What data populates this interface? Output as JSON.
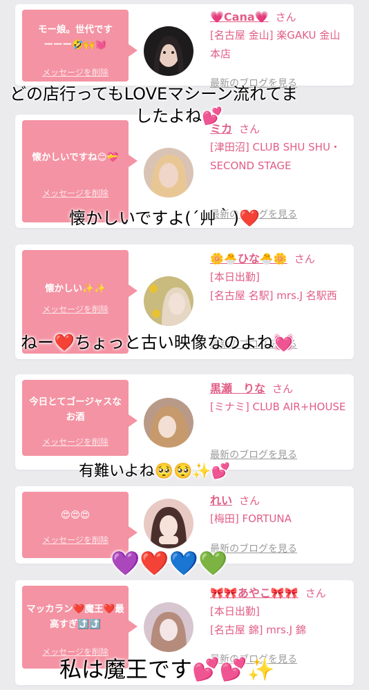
{
  "cards": [
    {
      "bubble_text": "モー娘。世代です\nーーー🤣🙌💓",
      "delete_label": "メッセージを削除",
      "name": "💗Cana💗",
      "san": "さん",
      "shop": "[名古屋 金山] 楽GAKU 金山本店",
      "blog": "最新のブログを見る"
    },
    {
      "bubble_text": "懐かしいですね😊💝",
      "delete_label": "メッセージを削除",
      "name": "ミカ",
      "san": "さん",
      "shop": "[津田沼] CLUB SHU SHU・SECOND STAGE",
      "blog": "最新のブログを見る"
    },
    {
      "bubble_text": "懐かしい✨✨",
      "delete_label": "メッセージを削除",
      "name": "🌼🐣ひな🐣🌼",
      "san": "さん",
      "shop": "[本日出勤]\n[名古屋 名駅] mrs.J 名駅西",
      "blog": "最新のブログを見る"
    },
    {
      "bubble_text": "今日とてゴージャスなお酒",
      "delete_label": "メッセージを削除",
      "name": "黒瀬　りな",
      "san": "さん",
      "shop": "[ミナミ] CLUB AIR+HOUSE",
      "blog": "最新のブログを見る"
    },
    {
      "bubble_text": "😍😍😍",
      "delete_label": "メッセージを削除",
      "name": "れい",
      "san": "さん",
      "shop": "[梅田] FORTUNA",
      "blog": "最新のブログを見る"
    },
    {
      "bubble_text": "マッカラン❤️魔王❤️最高すぎ⤴️⤴️",
      "delete_label": "メッセージを削除",
      "name": "🎀🎀あやこ🎀🎀",
      "san": "さん",
      "shop": "[本日出勤]\n[名古屋 錦] mrs.J 錦",
      "blog": "最新のブログを見る"
    }
  ],
  "captions": {
    "c1_line1": "どの店行ってもLOVEマシーン流れてま",
    "c1_line2": "したよね💕",
    "c2": "懐かしいですよ(´艸｀)❤️",
    "c3": "ねー❤️ちょっと古い映像なのよね💓",
    "c4": "有難いよね🥺🥺✨💕",
    "c5": "💜❤️💙💚",
    "c6": "私は魔王です💕💕✨"
  },
  "colors": {
    "bubble": "#f493a3",
    "accent": "#e15d86",
    "background": "#ebebee"
  }
}
